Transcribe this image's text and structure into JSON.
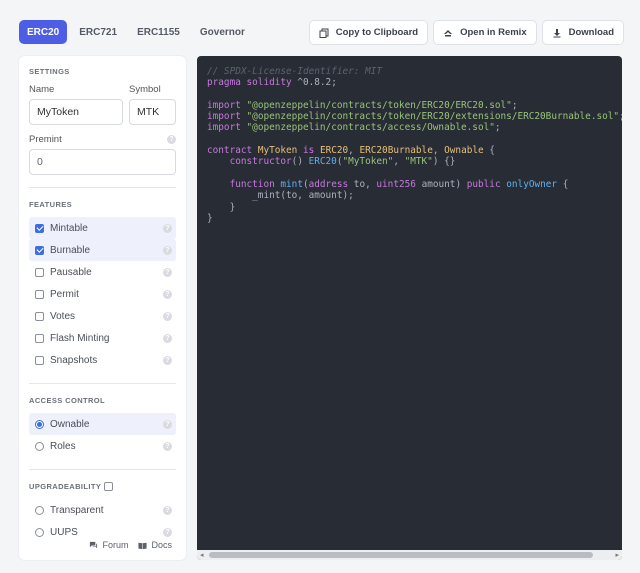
{
  "tabs": [
    "ERC20",
    "ERC721",
    "ERC1155",
    "Governor"
  ],
  "actions": {
    "copy": "Copy to Clipboard",
    "remix": "Open in Remix",
    "download": "Download"
  },
  "settings": {
    "title": "SETTINGS",
    "name_label": "Name",
    "name_value": "MyToken",
    "symbol_label": "Symbol",
    "symbol_value": "MTK",
    "premint_label": "Premint",
    "premint_value": "0"
  },
  "features": {
    "title": "FEATURES",
    "items": [
      {
        "label": "Mintable",
        "checked": true
      },
      {
        "label": "Burnable",
        "checked": true
      },
      {
        "label": "Pausable",
        "checked": false
      },
      {
        "label": "Permit",
        "checked": false
      },
      {
        "label": "Votes",
        "checked": false
      },
      {
        "label": "Flash Minting",
        "checked": false
      },
      {
        "label": "Snapshots",
        "checked": false
      }
    ]
  },
  "access": {
    "title": "ACCESS CONTROL",
    "items": [
      {
        "label": "Ownable",
        "selected": true
      },
      {
        "label": "Roles",
        "selected": false
      }
    ]
  },
  "upgradeability": {
    "title": "UPGRADEABILITY",
    "items": [
      {
        "label": "Transparent",
        "selected": false
      },
      {
        "label": "UUPS",
        "selected": false
      }
    ]
  },
  "footer": {
    "forum": "Forum",
    "docs": "Docs"
  },
  "code": {
    "license": "// SPDX-License-Identifier: MIT",
    "pragma_kw": "pragma solidity",
    "pragma_ver": "^0.8.2;",
    "import_kw": "import",
    "imports": [
      "\"@openzeppelin/contracts/token/ERC20/ERC20.sol\"",
      "\"@openzeppelin/contracts/token/ERC20/extensions/ERC20Burnable.sol\"",
      "\"@openzeppelin/contracts/access/Ownable.sol\""
    ],
    "contract_kw": "contract",
    "contract_name": "MyToken",
    "is_kw": "is",
    "bases": [
      "ERC20",
      "ERC20Burnable",
      "Ownable"
    ],
    "ctor_kw": "constructor",
    "ctor_base": "ERC20",
    "ctor_args": [
      "\"MyToken\"",
      "\"MTK\""
    ],
    "fn_kw": "function",
    "fn_name": "mint",
    "param1_type": "address",
    "param1_name": "to",
    "param2_type": "uint256",
    "param2_name": "amount",
    "public_kw": "public",
    "modifier": "onlyOwner",
    "body": "_mint(to, amount);"
  },
  "colors": {
    "accent": "#4e5ee4",
    "code_bg": "#282c34"
  }
}
